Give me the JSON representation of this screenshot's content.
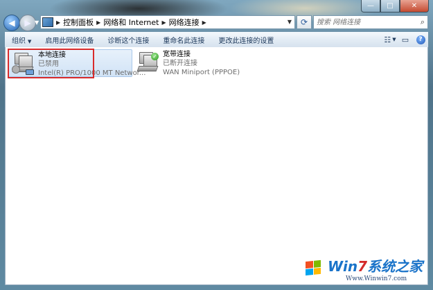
{
  "window": {
    "caption_buttons": {
      "minimize": "—",
      "maximize": "□",
      "close": "✕"
    }
  },
  "address_bar": {
    "breadcrumbs": [
      "控制面板",
      "网络和 Internet",
      "网络连接"
    ],
    "search_placeholder": "搜索 网络连接"
  },
  "toolbar": {
    "organize": "组织",
    "items": [
      "启用此网络设备",
      "诊断这个连接",
      "重命名此连接",
      "更改此连接的设置"
    ]
  },
  "connections": [
    {
      "name": "本地连接",
      "status": "已禁用",
      "device": "Intel(R) PRO/1000 MT Networ...",
      "icon": "wired-network-icon"
    },
    {
      "name": "宽带连接",
      "status": "已断开连接",
      "device": "WAN Miniport (PPPOE)",
      "icon": "broadband-network-icon"
    }
  ],
  "watermark": {
    "brand_a": "Win",
    "brand_seven": "7",
    "brand_b": "系统之家",
    "url": "Www.Winwin7.com"
  },
  "colors": {
    "highlight_box": "#d92b2b",
    "selected_tile": "#d1e3f6",
    "toolbar_text": "#1e395b"
  }
}
